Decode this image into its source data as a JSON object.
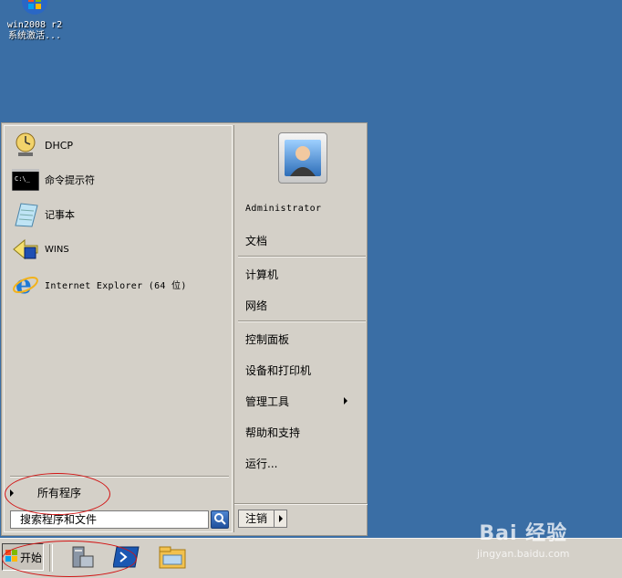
{
  "desktop": {
    "icon_label_line1": "win2008 r2",
    "icon_label_line2": "系统激活..."
  },
  "start_menu": {
    "pinned_programs": [
      {
        "label": "DHCP",
        "icon": "dhcp-clock-icon"
      },
      {
        "label": "命令提示符",
        "icon": "command-prompt-icon"
      },
      {
        "label": "记事本",
        "icon": "notepad-icon"
      },
      {
        "label": "WINS",
        "icon": "wins-icon"
      },
      {
        "label": "Internet Explorer (64 位)",
        "icon": "internet-explorer-icon"
      }
    ],
    "all_programs_label": "所有程序",
    "search_placeholder": "搜索程序和文件",
    "right_items": {
      "user": "Administrator",
      "documents": "文档",
      "computer": "计算机",
      "network": "网络",
      "control_panel": "控制面板",
      "devices_printers": "设备和打印机",
      "admin_tools": "管理工具",
      "help_support": "帮助和支持",
      "run": "运行..."
    },
    "logoff_label": "注销"
  },
  "taskbar": {
    "start_label": "开始",
    "pinned": [
      "server-manager-icon",
      "powershell-icon",
      "explorer-folder-icon"
    ]
  },
  "watermark": {
    "brand": "Bai 经验",
    "url": "jingyan.baidu.com"
  },
  "colors": {
    "desktop": "#3a6ea5",
    "menu": "#d4d0c8",
    "annotation": "#d21414"
  }
}
